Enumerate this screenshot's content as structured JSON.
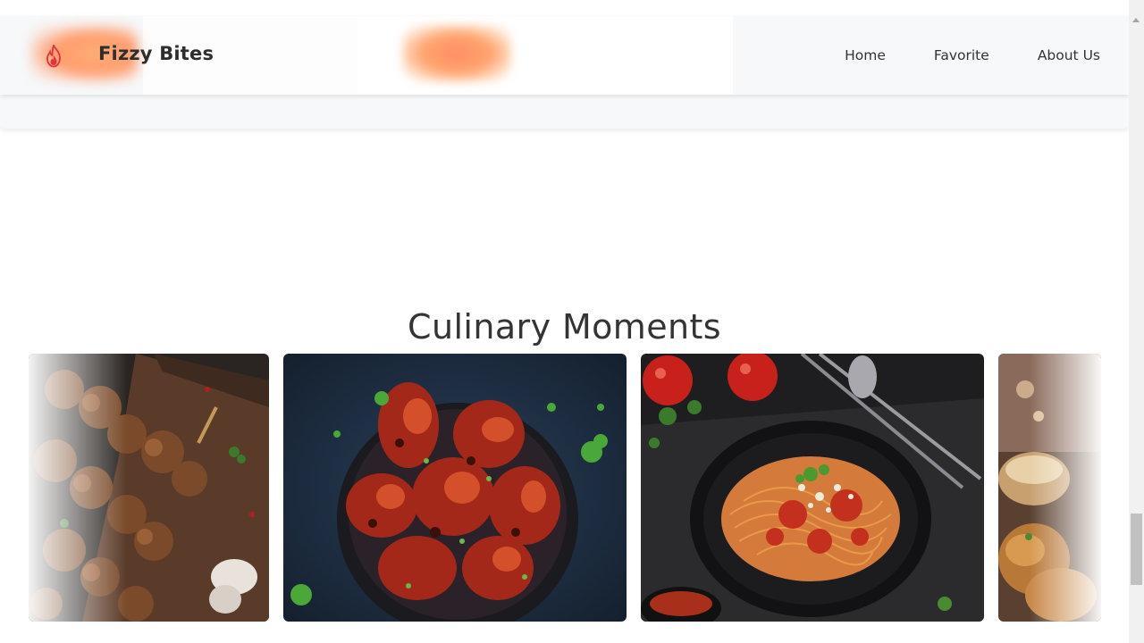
{
  "navbar": {
    "brand": "Fizzy Bites",
    "logo_icon": "flame-icon",
    "links": [
      {
        "label": "Home"
      },
      {
        "label": "Favorite"
      },
      {
        "label": "About Us"
      }
    ],
    "colors": {
      "logo_flame": "#e4313a",
      "logo_glow": "#ff9a6a",
      "background": "#f7f8fa"
    }
  },
  "section": {
    "title": "Culinary Moments"
  },
  "gallery": {
    "items": [
      {
        "name": "kebab-skewers-image"
      },
      {
        "name": "grilled-chicken-wings-image"
      },
      {
        "name": "spaghetti-pasta-image"
      },
      {
        "name": "dessert-image"
      }
    ]
  }
}
